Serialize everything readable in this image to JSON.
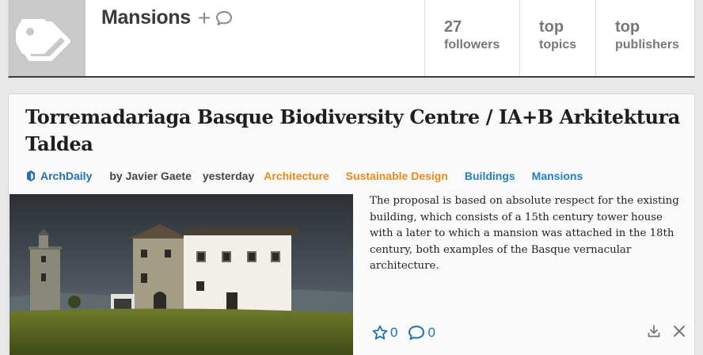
{
  "topic": {
    "title": "Mansions",
    "plus_label": "+",
    "stats": [
      {
        "value": "27",
        "label": "followers"
      },
      {
        "value": "top",
        "label": "topics"
      },
      {
        "value": "top",
        "label": "publishers"
      }
    ]
  },
  "article": {
    "title": "Torremadariaga Basque Biodiversity Centre / IA+B Arkitektura Taldea",
    "publisher": "ArchDaily",
    "byline": "by Javier Gaete",
    "time": "yesterday",
    "tags": [
      {
        "label": "Architecture",
        "color": "#e8891a"
      },
      {
        "label": "Sustainable Design",
        "color": "#e8891a"
      },
      {
        "label": "Buildings",
        "color": "#1f7fc0"
      },
      {
        "label": "Mansions",
        "color": "#1f7fc0"
      }
    ],
    "summary": "The proposal is based on absolute respect for the existing building, which consists of a 15th century tower house with a later to which a mansion was attached in the 18th century, both examples of the Basque vernacular architecture.",
    "likes": "0",
    "comments": "0"
  },
  "icons": {
    "topic_tile": "tag-icon",
    "comment": "comment-icon",
    "publisher": "archdaily-icon",
    "star": "star-icon",
    "download": "download-icon",
    "close": "close-icon"
  },
  "colors": {
    "link_blue": "#1f6fb2",
    "tag_orange": "#e8891a",
    "tag_blue": "#1f7fc0",
    "header_rule": "#3c3c3c"
  }
}
